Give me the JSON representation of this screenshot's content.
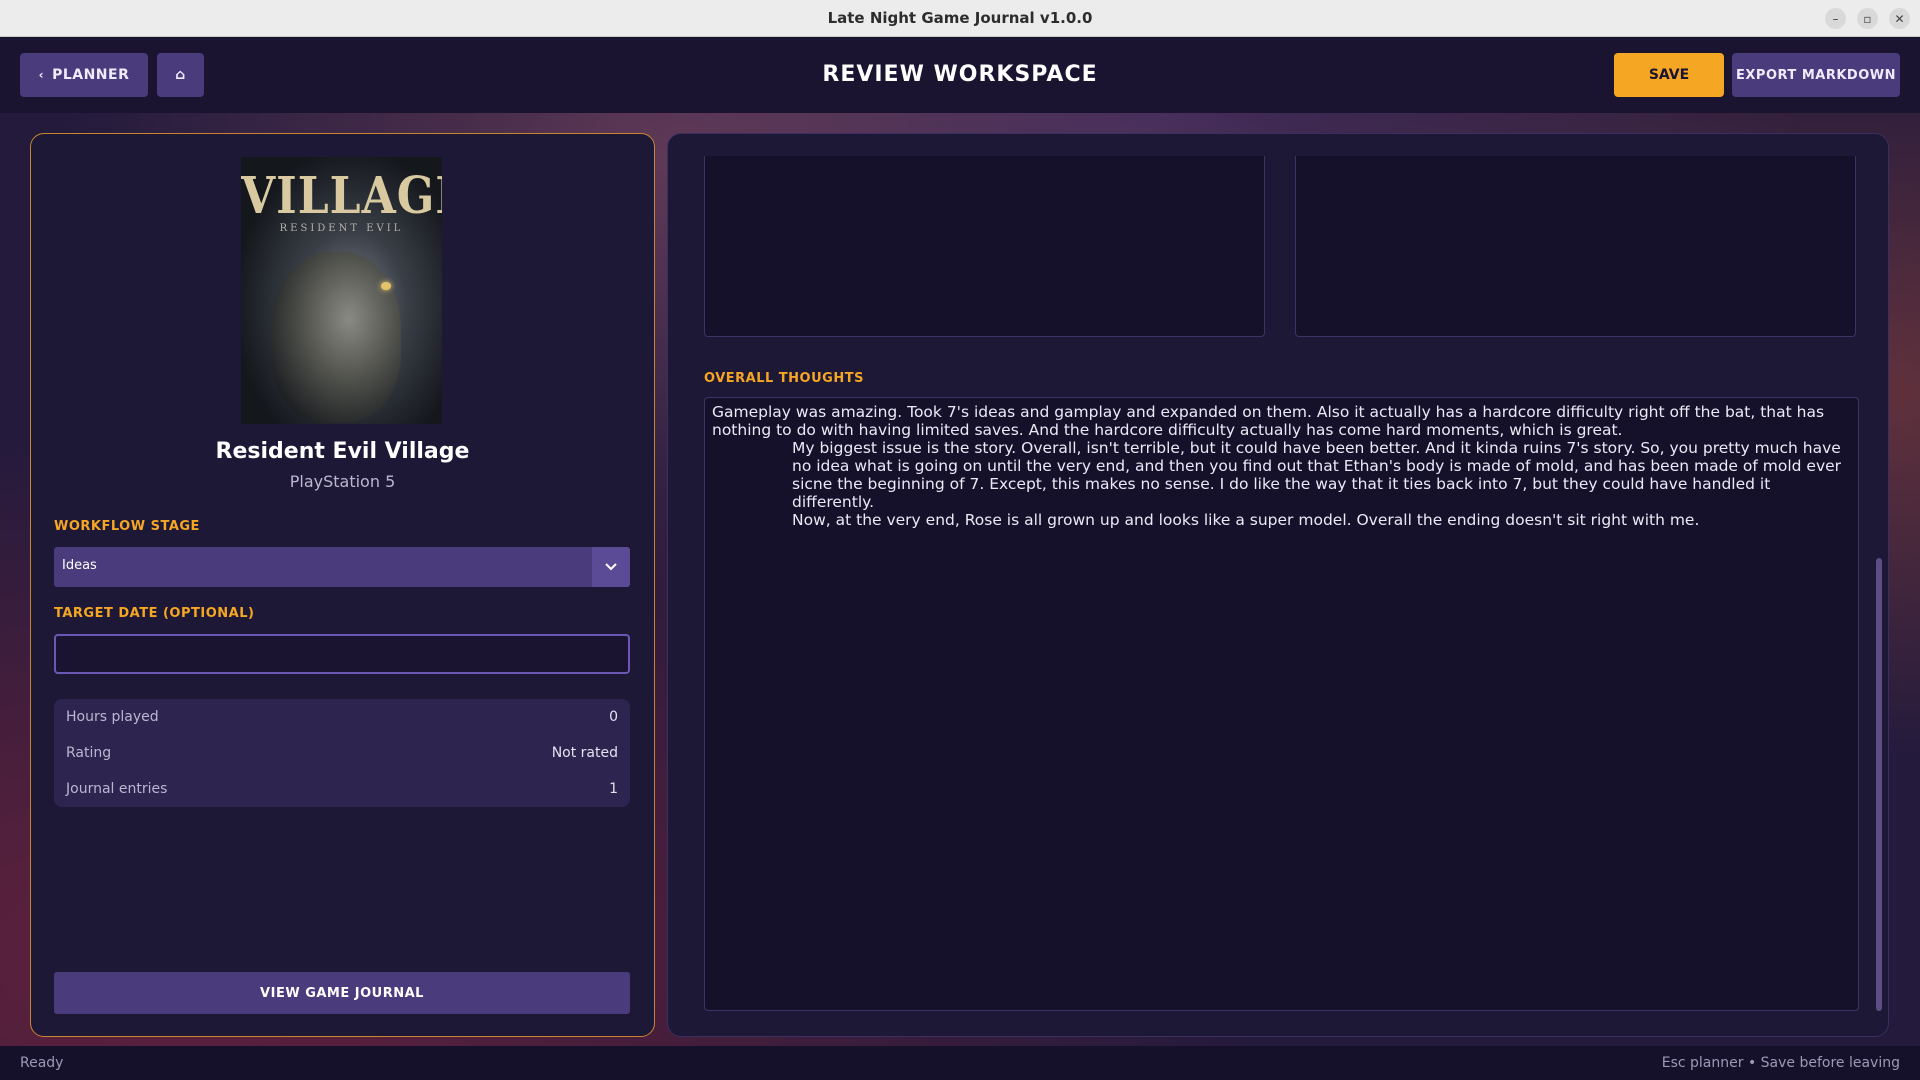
{
  "window": {
    "title": "Late Night Game Journal v1.0.0",
    "controls": [
      "minimize-icon",
      "restore-icon",
      "close-icon"
    ]
  },
  "header": {
    "back_label": "PLANNER",
    "home_icon": "home-icon",
    "title": "REVIEW WORKSPACE",
    "save_label": "SAVE",
    "export_label": "EXPORT MARKDOWN"
  },
  "game": {
    "cover_title": "VILLAGE",
    "cover_subtitle": "RESIDENT EVIL",
    "name": "Resident Evil Village",
    "platform": "PlayStation 5"
  },
  "workflow": {
    "label": "WORKFLOW STAGE",
    "selected": "Ideas"
  },
  "target_date": {
    "label": "TARGET DATE (OPTIONAL)",
    "value": "",
    "placeholder": ""
  },
  "stats": [
    {
      "label": "Hours played",
      "value": "0"
    },
    {
      "label": "Rating",
      "value": "Not rated"
    },
    {
      "label": "Journal entries",
      "value": "1"
    }
  ],
  "view_journal_label": "VIEW GAME JOURNAL",
  "thoughts": {
    "label": "OVERALL THOUGHTS",
    "paragraphs": [
      "Gameplay was amazing. Took 7's ideas and gamplay and expanded on them. Also it actually has a hardcore difficulty right off the bat, that has nothing to do with having limited saves. And the hardcore difficulty actually has come hard moments, which is great.",
      "My biggest issue is the story. Overall, isn't terrible, but it could have been better. And it kinda ruins 7's story. So, you pretty much have no idea what is going on until the very end, and then you find out that Ethan's body is made of mold, and has been made of mold ever sicne the beginning of 7. Except, this makes no sense. I do like the way that it ties back into 7, but they could have handled it differently.",
      "Now, at the very end, Rose is all grown up and looks like a super model. Overall the ending doesn't sit right with me."
    ]
  },
  "status": {
    "left": "Ready",
    "right": "Esc planner  •  Save before leaving"
  },
  "colors": {
    "accent": "#f5a623",
    "button": "#4a3b7d",
    "panel": "#1e1837",
    "background": "#1a1430"
  }
}
